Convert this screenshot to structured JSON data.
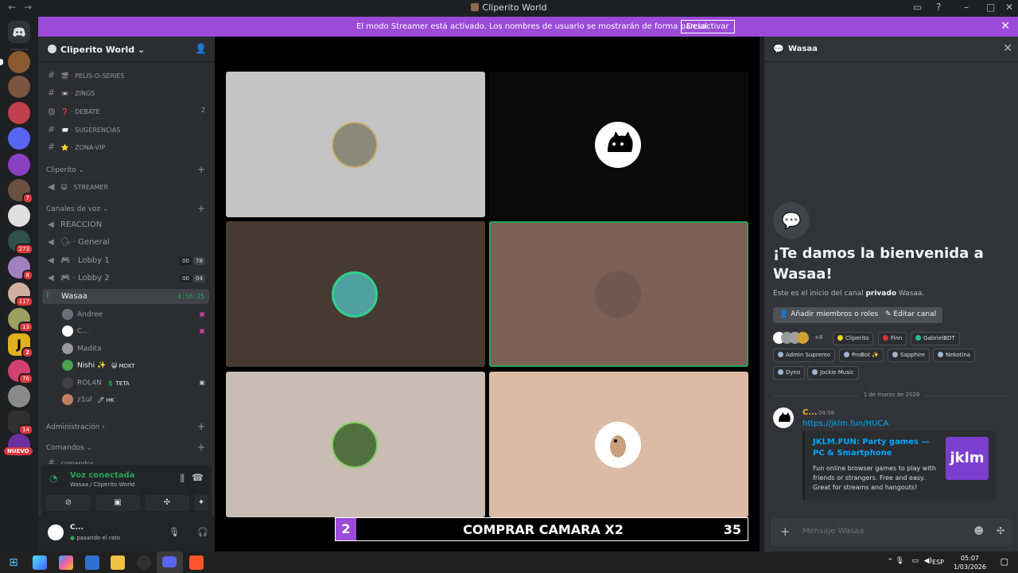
{
  "window": {
    "title": "Cliperito World",
    "back": "←",
    "forward": "→"
  },
  "banner": {
    "message": "El modo Streamer está activado. Los nombres de usuario se mostrarán de forma parcial.",
    "button": "Desactivar"
  },
  "rail": {
    "badges": [
      "7",
      "273",
      "8",
      "117",
      "13",
      "2",
      "76",
      "14"
    ],
    "new_label": "NUEVO"
  },
  "guild": {
    "name": "Cliperito World"
  },
  "text_channels": [
    {
      "emoji": "🎬",
      "name": "pelis-o-series"
    },
    {
      "emoji": "📼",
      "name": "zings"
    },
    {
      "emoji": "❓",
      "name": "debate",
      "count": "2"
    },
    {
      "emoji": "📨",
      "name": "sugerencias"
    },
    {
      "emoji": "⭐",
      "name": "zona-vip"
    }
  ],
  "cat_cliperito": "Cliperito",
  "streamer_channel": {
    "emoji": "😺",
    "name": "STREAMER"
  },
  "cat_voice": "Canales de voz",
  "voice_channels": [
    {
      "name": "REACCION"
    },
    {
      "emoji": "🗣",
      "name": "General"
    },
    {
      "emoji": "🎮",
      "name": "Lobby 1",
      "tag1": "00",
      "tag2": "78"
    },
    {
      "emoji": "🎮",
      "name": "Lobby 2",
      "tag1": "00",
      "tag2": "04"
    }
  ],
  "active_voice": {
    "name": "Wasaa",
    "timer": "4:56:25"
  },
  "voice_members": [
    {
      "name": "Andree"
    },
    {
      "name": "C..."
    },
    {
      "name": "Madita"
    },
    {
      "name": "Nishi ✨",
      "tag": "😺 MDKT"
    },
    {
      "name": "ROL4N",
      "tag": "💲 TETA"
    },
    {
      "name": "z1ul",
      "tag": "🖊 HK"
    }
  ],
  "cat_admin": "Administración",
  "cat_commands": "Comandos",
  "cmd_channel": "comandos",
  "voice_panel": {
    "connected": "Voz conectada",
    "location": "Wasaa / Cliperito World"
  },
  "user": {
    "name": "C...",
    "status": "pasando el rato"
  },
  "tile_colors": [
    "#c4c4c4",
    "#0a0a0a",
    "#463a31",
    "#7a6055",
    "#c9bcb3",
    "#dcbba5"
  ],
  "overlay": {
    "number": "2",
    "text": "COMPRAR CAMARA X2",
    "count": "35"
  },
  "side": {
    "title": "Wasaa",
    "welcome": "¡Te damos la bienvenida a Wasaa!",
    "intro_pre": "Este es el inicio del canal ",
    "intro_bold": "privado",
    "intro_post": " Wasaa.",
    "add_button": "Añadir miembros o roles",
    "edit_button": "Editar canal",
    "more": "+8",
    "roles": [
      {
        "name": "Cliperito",
        "color": "#f0d020"
      },
      {
        "name": "Finn",
        "color": "#e03030"
      },
      {
        "name": "GabrielBDT",
        "color": "#20c090"
      },
      {
        "name": "Admin Supremo",
        "color": "#a0b4d0"
      },
      {
        "name": "ProBot ✨",
        "color": "#a0b4d0"
      },
      {
        "name": "Sapphire",
        "color": "#a0b4d0"
      },
      {
        "name": "Nekotina",
        "color": "#a0b4d0"
      },
      {
        "name": "Dyno",
        "color": "#a0b4d0"
      },
      {
        "name": "Jockie Music",
        "color": "#a0b4d0"
      }
    ],
    "date_divider": "1 de marzo de 2026",
    "message": {
      "author": "C...",
      "time": "04:58",
      "link": "https://jklm.fun/HUCA",
      "embed_title": "JKLM.FUN: Party games — PC & Smartphone",
      "embed_desc": "Fun online browser games to play with friends or strangers. Free and easy. Great for streams and hangouts!",
      "embed_logo": "jklm"
    },
    "composer_placeholder": "Mensaje Wasaa"
  },
  "taskbar": {
    "language": "ESP",
    "time": "05:07",
    "date": "1/03/2026"
  }
}
